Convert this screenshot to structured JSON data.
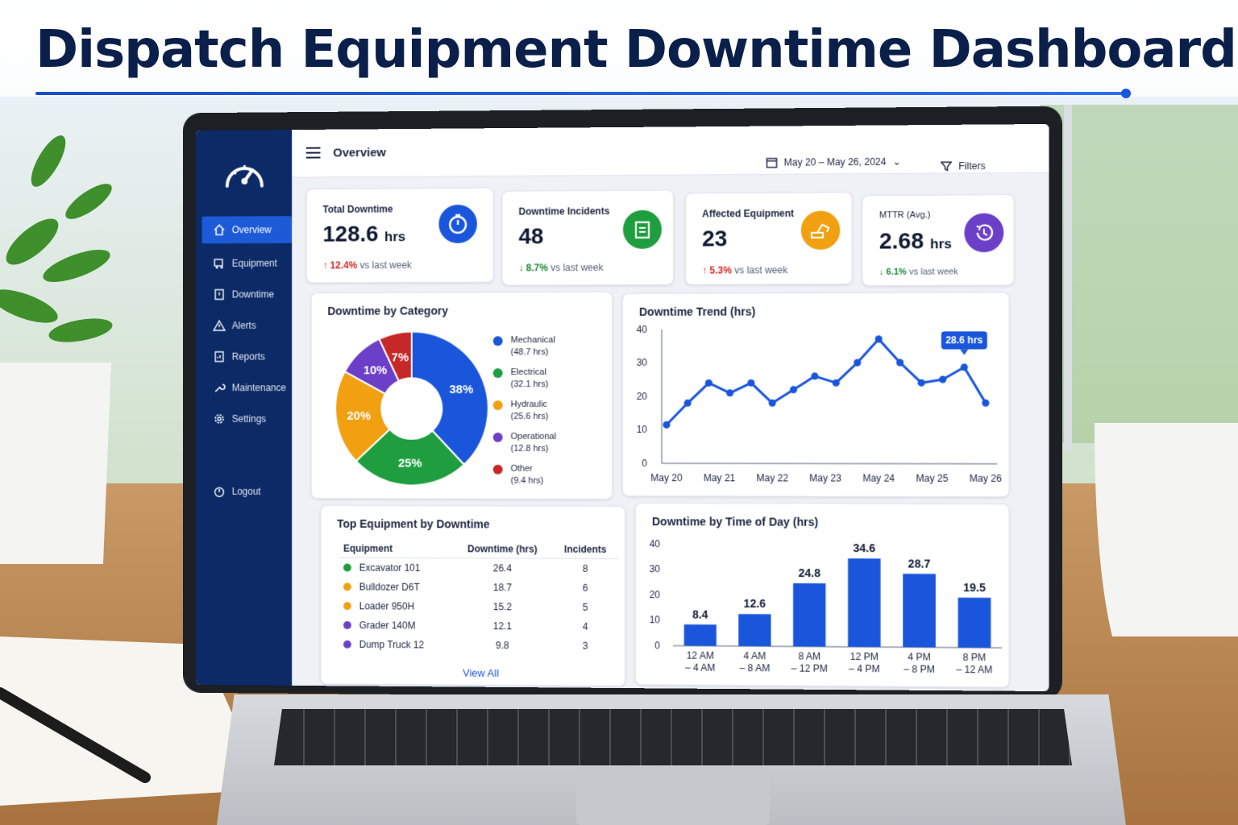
{
  "title": "Dispatch Equipment Downtime Dashboard",
  "topbar": {
    "page_title": "Overview",
    "date_range": "May 20 – May 26, 2024",
    "filters_label": "Filters"
  },
  "sidebar": {
    "items": [
      {
        "label": "Overview",
        "icon": "home-icon",
        "active": true
      },
      {
        "label": "Equipment",
        "icon": "truck-icon"
      },
      {
        "label": "Downtime",
        "icon": "clock-icon"
      },
      {
        "label": "Alerts",
        "icon": "warning-icon"
      },
      {
        "label": "Reports",
        "icon": "report-icon"
      },
      {
        "label": "Maintenance",
        "icon": "wrench-icon"
      },
      {
        "label": "Settings",
        "icon": "gear-icon"
      }
    ],
    "logout_label": "Logout"
  },
  "kpis": [
    {
      "label": "Total Downtime",
      "value": "128.6",
      "unit": "hrs",
      "delta": "12.4%",
      "arrow": "↑",
      "direction": "up",
      "compare": "vs last week",
      "icon": "stopwatch-icon",
      "color": "#1a56db"
    },
    {
      "label": "Downtime Incidents",
      "value": "48",
      "unit": "",
      "delta": "8.7%",
      "arrow": "↓",
      "direction": "down",
      "compare": "vs last week",
      "icon": "clipboard-icon",
      "color": "#1e9e3e"
    },
    {
      "label": "Affected Equipment",
      "value": "23",
      "unit": "",
      "delta": "5.3%",
      "arrow": "↑",
      "direction": "up",
      "compare": "vs last week",
      "icon": "excavator-icon",
      "color": "#f0a010"
    },
    {
      "label": "MTTR (Avg.)",
      "value": "2.68",
      "unit": "hrs",
      "delta": "6.1%",
      "arrow": "↓",
      "direction": "down",
      "compare": "vs last week",
      "icon": "history-icon",
      "color": "#6b3fc7"
    }
  ],
  "category_chart": {
    "title": "Downtime by Category",
    "chart_data": {
      "type": "pie",
      "slices": [
        {
          "label": "Mechanical",
          "detail": "(48.7 hrs)",
          "percent": 38,
          "percent_label": "38%",
          "color": "#1a56db"
        },
        {
          "label": "Electrical",
          "detail": "(32.1 hrs)",
          "percent": 25,
          "percent_label": "25%",
          "color": "#1e9e3e"
        },
        {
          "label": "Hydraulic",
          "detail": "(25.6 hrs)",
          "percent": 20,
          "percent_label": "20%",
          "color": "#f0a010"
        },
        {
          "label": "Operational",
          "detail": "(12.8 hrs)",
          "percent": 10,
          "percent_label": "10%",
          "color": "#6b3fc7"
        },
        {
          "label": "Other",
          "detail": "(9.4 hrs)",
          "percent": 7,
          "percent_label": "7%",
          "color": "#c62828"
        }
      ]
    }
  },
  "trend_chart": {
    "title": "Downtime Trend (hrs)",
    "chart_data": {
      "type": "line",
      "x_ticks": [
        "May 20",
        "May 21",
        "May 22",
        "May 23",
        "May 24",
        "May 25",
        "May 26"
      ],
      "y_ticks": [
        "0",
        "10",
        "20",
        "30",
        "40"
      ],
      "ylim": [
        0,
        40
      ],
      "values": [
        11.5,
        18,
        24,
        21,
        24,
        18,
        22,
        26,
        24,
        30,
        37,
        30,
        24,
        25,
        28.6,
        18
      ],
      "callout": "28.6 hrs",
      "callout_index": 14,
      "color": "#1a56db"
    }
  },
  "equipment_table": {
    "title": "Top Equipment by Downtime",
    "columns": [
      "Equipment",
      "Downtime (hrs)",
      "Incidents"
    ],
    "rows": [
      {
        "name": "Excavator 101",
        "downtime": "26.4",
        "incidents": "8",
        "color": "#1e9e3e"
      },
      {
        "name": "Bulldozer D6T",
        "downtime": "18.7",
        "incidents": "6",
        "color": "#f0a010"
      },
      {
        "name": "Loader 950H",
        "downtime": "15.2",
        "incidents": "5",
        "color": "#f0a010"
      },
      {
        "name": "Grader 140M",
        "downtime": "12.1",
        "incidents": "4",
        "color": "#6b3fc7"
      },
      {
        "name": "Dump Truck 12",
        "downtime": "9.8",
        "incidents": "3",
        "color": "#6b3fc7"
      }
    ],
    "view_all": "View All"
  },
  "time_chart": {
    "title": "Downtime by Time of Day (hrs)",
    "chart_data": {
      "type": "bar",
      "categories": [
        [
          "12 AM",
          "– 4 AM"
        ],
        [
          "4 AM",
          "– 8 AM"
        ],
        [
          "8 AM",
          "– 12 PM"
        ],
        [
          "12 PM",
          "– 4 PM"
        ],
        [
          "4 PM",
          "– 8 PM"
        ],
        [
          "8 PM",
          "– 12 AM"
        ]
      ],
      "values": [
        8.4,
        12.6,
        24.8,
        34.6,
        28.7,
        19.5
      ],
      "value_labels": [
        "8.4",
        "12.6",
        "24.8",
        "34.6",
        "28.7",
        "19.5"
      ],
      "y_ticks": [
        "0",
        "10",
        "20",
        "30",
        "40"
      ],
      "ylim": [
        0,
        40
      ],
      "color": "#1a56db"
    }
  }
}
